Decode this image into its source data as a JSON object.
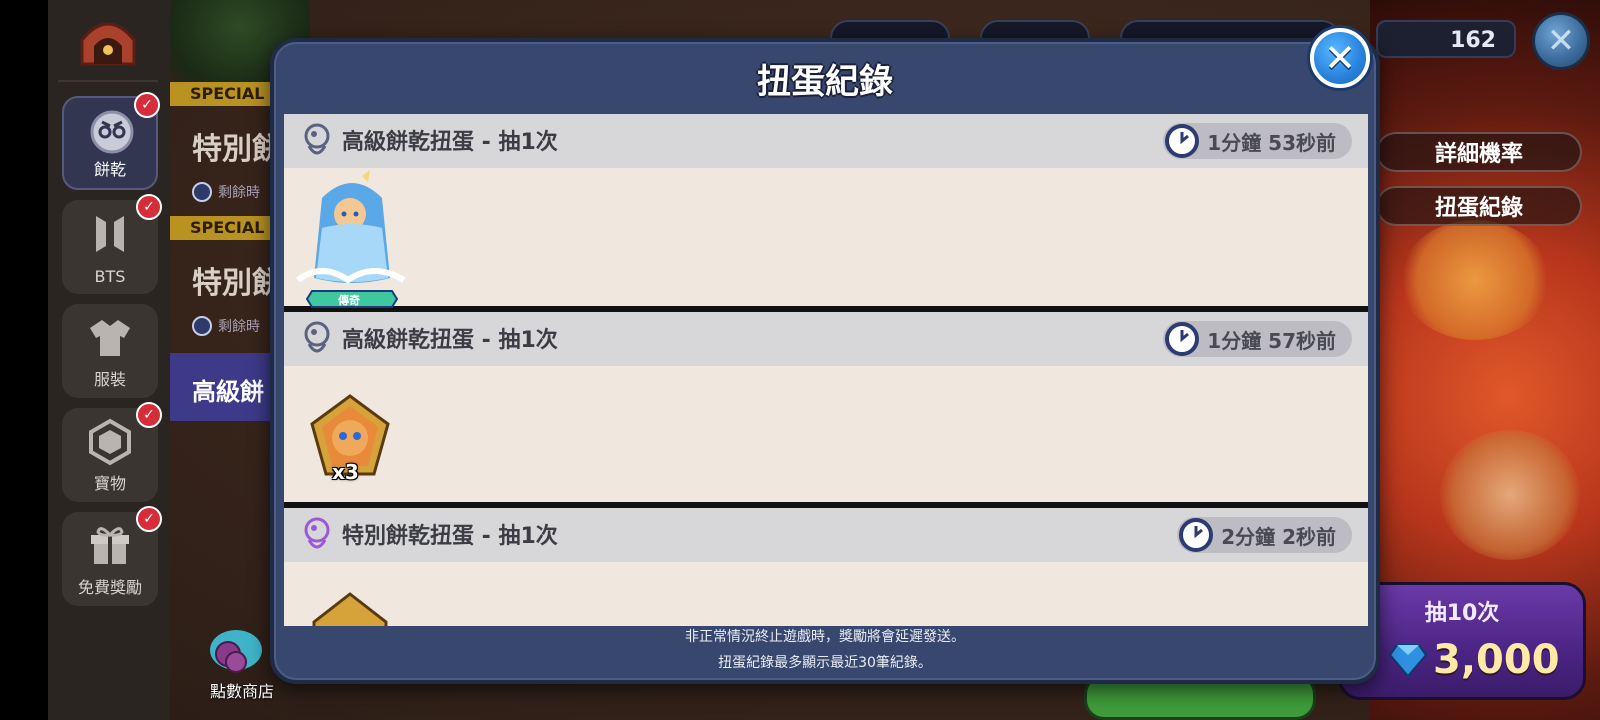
{
  "sidebar": {
    "items": [
      {
        "label": "餅乾",
        "icon": "cookie-face-icon",
        "active": true,
        "badge": true
      },
      {
        "label": "BTS",
        "icon": "bts-logo-icon",
        "active": false,
        "badge": true
      },
      {
        "label": "服裝",
        "icon": "shirt-icon",
        "active": false,
        "badge": false
      },
      {
        "label": "寶物",
        "icon": "hexagon-treasure-icon",
        "active": false,
        "badge": true
      },
      {
        "label": "免費獎勵",
        "icon": "gift-icon",
        "active": false,
        "badge": true
      }
    ],
    "points_shop_label": "點數商店"
  },
  "banners": {
    "special_tag": "SPECIAL",
    "items": [
      {
        "tag": "SPECIAL",
        "title": "特別餅",
        "remaining": "剩餘時"
      },
      {
        "tag": "SPECIAL",
        "title": "特別餅",
        "remaining": "剩餘時"
      }
    ],
    "active_title": "高級餅"
  },
  "topbar": {
    "gem_count": "162"
  },
  "right_panel": {
    "odds_button": "詳細機率",
    "history_button": "扭蛋紀錄",
    "draw10_label": "抽10次",
    "draw10_price": "3,000"
  },
  "modal": {
    "title": "扭蛋紀錄",
    "entries": [
      {
        "name": "高級餅乾扭蛋 - 抽1次",
        "time": "1分鐘 53秒前",
        "gacha_icon": "premium-gacha-icon",
        "reward_icon": "sea-fairy-cookie-icon",
        "rarity": "傳奇"
      },
      {
        "name": "高級餅乾扭蛋 - 抽1次",
        "time": "1分鐘 57秒前",
        "gacha_icon": "premium-gacha-icon",
        "reward_icon": "cookie-soulstone-icon",
        "quantity": "x3"
      },
      {
        "name": "特別餅乾扭蛋 - 抽1次",
        "time": "2分鐘 2秒前",
        "gacha_icon": "special-gacha-icon",
        "reward_icon": "soulstone-icon"
      }
    ],
    "footer_line1": "非正常情況終止遊戲時，獎勵將會延遲發送。",
    "footer_line2": "扭蛋紀錄最多顯示最近30筆紀錄。"
  },
  "colors": {
    "modal_bg": "#38476e",
    "entry_bg": "#f0e8df",
    "entry_head": "#d7d7d9",
    "badge_red": "#d72c3a",
    "close_blue": "#2a86e0",
    "special_gold": "#b99222"
  }
}
